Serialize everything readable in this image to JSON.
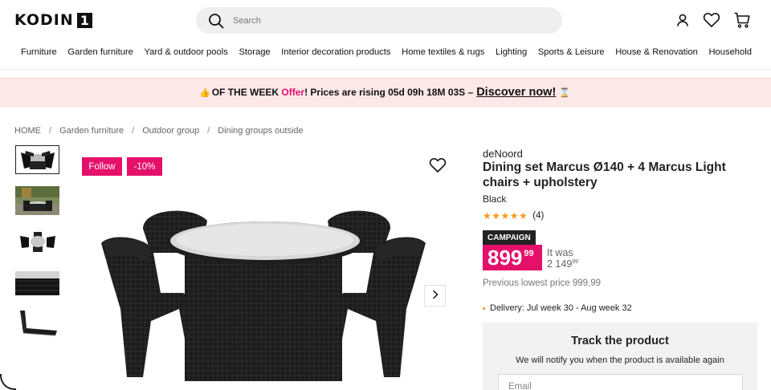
{
  "header": {
    "logo_text": "KODIN",
    "logo_number": "1",
    "search_placeholder": "Search",
    "icons": [
      "search-icon",
      "user-icon",
      "heart-icon",
      "cart-icon"
    ]
  },
  "nav": {
    "items": [
      "Furniture",
      "Garden furniture",
      "Yard & outdoor pools",
      "Storage",
      "Interior decoration products",
      "Home textiles & rugs",
      "Lighting",
      "Sports & Leisure",
      "House & Renovation",
      "Household"
    ]
  },
  "banner": {
    "lead_icon": "👍",
    "prefix": "OF THE WEEK",
    "offer": "Offer",
    "middle": "! Prices are rising 05d 09h 18M 03S –",
    "cta": "Discover now!",
    "trail_icon": "⌛"
  },
  "breadcrumb": [
    "HOME",
    "Garden furniture",
    "Outdoor group",
    "Dining groups outside"
  ],
  "gallery": {
    "follow_label": "Follow",
    "discount_label": "-10%",
    "thumbnail_count": 5
  },
  "product": {
    "brand": "deNoord",
    "title": "Dining set Marcus Ø140 + 4 Marcus Light chairs + upholstery",
    "color": "Black",
    "rating_stars": 5,
    "review_count": "(4)",
    "campaign_label": "CAMPAIGN",
    "price_main": "899",
    "price_cents": "99",
    "was_label": "It was",
    "was_price": "2 149",
    "was_cents": "99",
    "lowest_price": "Previous lowest price 999,99",
    "delivery": "Delivery: Jul week 30 - Aug week 32"
  },
  "track": {
    "title": "Track the product",
    "subtitle": "We will notify you when the product is available again",
    "email_placeholder": "Email"
  },
  "colors": {
    "accent": "#e4106a",
    "banner_bg": "#fde8e8",
    "star": "#f59a1b",
    "panel_bg": "#f2f2f2"
  }
}
